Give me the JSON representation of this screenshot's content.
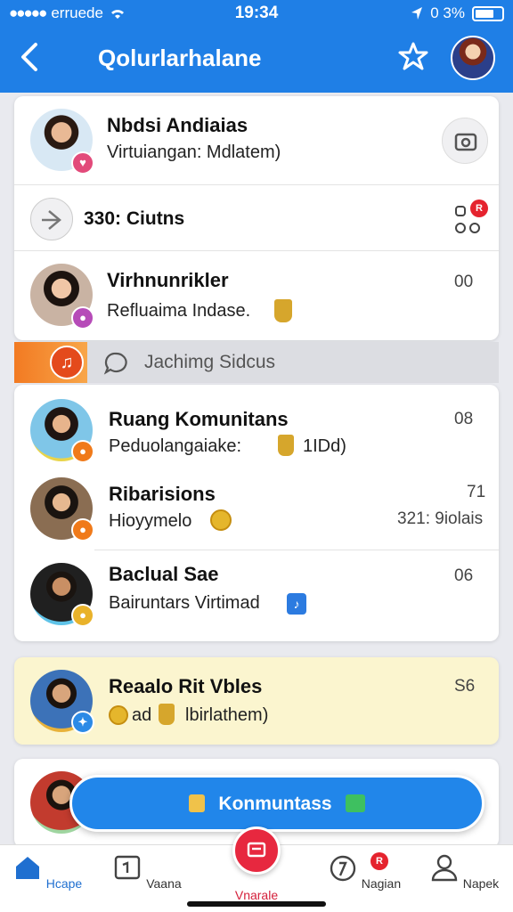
{
  "status": {
    "carrier": "erruede",
    "time": "19:34",
    "battery": "0 3%"
  },
  "header": {
    "title": "Qolurlarhalane"
  },
  "card1": {
    "profile": {
      "name": "Nbdsi Andiaias",
      "subtitle": "Virtuiangan: Mdlatem)"
    },
    "summary": {
      "text": "330: Ciutns",
      "badge": "R"
    },
    "item": {
      "name": "Virhnunrikler",
      "subtitle": "Refluaima Indase.",
      "meta": "00"
    }
  },
  "strip": {
    "text": "Jachimg Sidcus"
  },
  "card2": {
    "items": [
      {
        "name": "Ruang Komunitans",
        "subtitle": "Peduolangaiake:",
        "subtitle_extra": "1IDd)",
        "meta": "08"
      },
      {
        "name": "Ribarisions",
        "subtitle": "Hioyymelo",
        "meta": "71",
        "meta2": "321: 9iolais"
      },
      {
        "name": "Baclual Sae",
        "subtitle": "Bairuntars Virtimad",
        "meta": "06"
      }
    ]
  },
  "card3": {
    "name": "Reaalo Rit Vbles",
    "subtitle_a": "ad",
    "subtitle_b": "lbirlathem)",
    "meta": "S6"
  },
  "fab": {
    "label": "Konmuntass"
  },
  "tabs": [
    {
      "label": "Hcape"
    },
    {
      "label": "Vaana"
    },
    {
      "label": "Vnarale"
    },
    {
      "label": "Nagian",
      "badge": "R"
    },
    {
      "label": "Napek"
    }
  ],
  "colors": {
    "brand": "#1f7fe6",
    "accent_red": "#e7283f",
    "highlight_card": "#fbf5cf"
  }
}
